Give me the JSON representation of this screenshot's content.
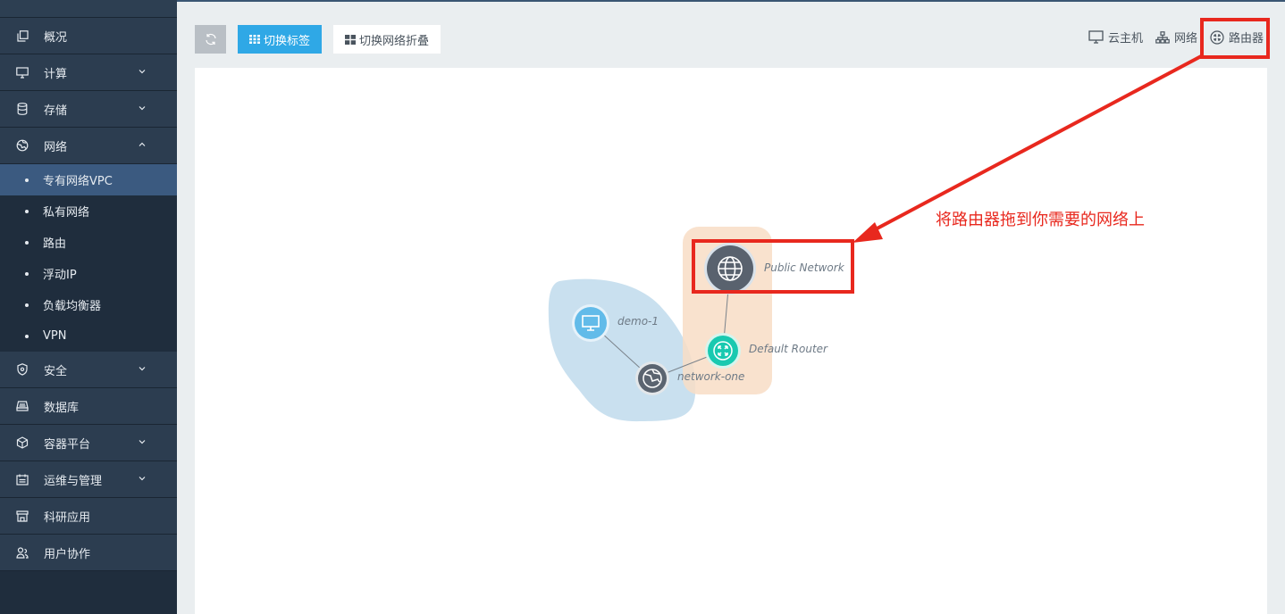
{
  "sidebar": {
    "items": [
      {
        "label": "概况",
        "icon": "copy-icon",
        "has_chevron": false
      },
      {
        "label": "计算",
        "icon": "monitor-icon",
        "has_chevron": true
      },
      {
        "label": "存储",
        "icon": "database-icon",
        "has_chevron": true
      },
      {
        "label": "网络",
        "icon": "globe-icon",
        "has_chevron": true,
        "expanded": true
      },
      {
        "label": "安全",
        "icon": "shield-icon",
        "has_chevron": true
      },
      {
        "label": "数据库",
        "icon": "db-server-icon",
        "has_chevron": false
      },
      {
        "label": "容器平台",
        "icon": "cube-icon",
        "has_chevron": true
      },
      {
        "label": "运维与管理",
        "icon": "calendar-icon",
        "has_chevron": true
      },
      {
        "label": "科研应用",
        "icon": "store-icon",
        "has_chevron": false
      },
      {
        "label": "用户协作",
        "icon": "users-icon",
        "has_chevron": false
      }
    ],
    "network_sub": [
      {
        "label": "专有网络VPC",
        "active": true
      },
      {
        "label": "私有网络"
      },
      {
        "label": "路由"
      },
      {
        "label": "浮动IP"
      },
      {
        "label": "负载均衡器"
      },
      {
        "label": "VPN"
      }
    ]
  },
  "toolbar": {
    "refresh_icon": "refresh-icon",
    "switch_tags_label": "切换标签",
    "switch_collapse_label": "切换网络折叠"
  },
  "palette": {
    "instance_label": "云主机",
    "network_label": "网络",
    "router_label": "路由器"
  },
  "topology": {
    "public_network_label": "Public Network",
    "instance_label": "demo-1",
    "network_label": "network-one",
    "router_label": "Default Router"
  },
  "annotation": {
    "text": "将路由器拖到你需要的网络上",
    "color": "#e8281e"
  },
  "colors": {
    "sidebar_bg": "#1f2d3d",
    "active_item": "#3b5a80",
    "primary_button": "#2fa8e6",
    "router_node": "#19c9b0",
    "instance_node": "#5fb8e8",
    "network_node": "#5b6470"
  }
}
